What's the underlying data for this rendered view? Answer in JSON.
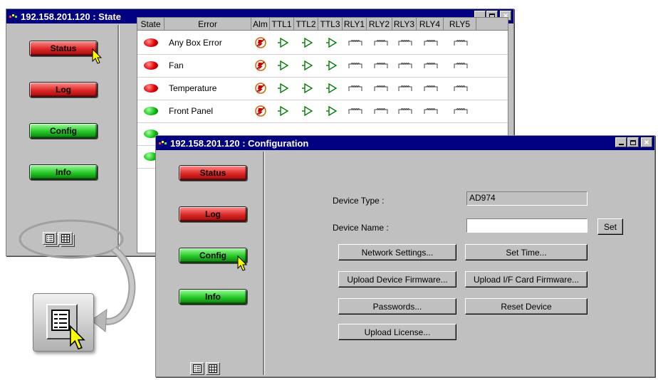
{
  "state_window": {
    "title": "192.158.201.120 : State",
    "nav": [
      {
        "label": "Status",
        "color": "red"
      },
      {
        "label": "Log",
        "color": "red"
      },
      {
        "label": "Config",
        "color": "green"
      },
      {
        "label": "Info",
        "color": "green"
      }
    ],
    "columns": [
      "State",
      "Error",
      "Alm",
      "TTL1",
      "TTL2",
      "TTL3",
      "RLY1",
      "RLY2",
      "RLY3",
      "RLY4",
      "RLY5"
    ],
    "rows": [
      {
        "state": "red",
        "error": "Any Box Error"
      },
      {
        "state": "red",
        "error": "Fan"
      },
      {
        "state": "red",
        "error": "Temperature"
      },
      {
        "state": "green",
        "error": "Front Panel"
      },
      {
        "state": "green",
        "error": ""
      },
      {
        "state": "green",
        "error": ""
      }
    ]
  },
  "config_window": {
    "title": "192.158.201.120 : Configuration",
    "nav": [
      {
        "label": "Status",
        "color": "red"
      },
      {
        "label": "Log",
        "color": "red"
      },
      {
        "label": "Config",
        "color": "green"
      },
      {
        "label": "Info",
        "color": "green"
      }
    ],
    "device_type_label": "Device Type :",
    "device_type_value": "AD974",
    "device_name_label": "Device Name :",
    "device_name_value": "",
    "set_label": "Set",
    "buttons": {
      "network_settings": "Network Settings...",
      "set_time": "Set Time...",
      "upload_device_firmware": "Upload Device Firmware...",
      "upload_if_card_firmware": "Upload I/F Card Firmware...",
      "passwords": "Passwords...",
      "reset_device": "Reset Device",
      "upload_license": "Upload License..."
    }
  },
  "colors": {
    "title_bar": "#000080",
    "window_bg": "#c0c0c0",
    "nav_red": "#dd2626",
    "nav_green": "#25c825"
  },
  "icons": [
    "alarm-disabled-icon",
    "ttl-output-icon",
    "relay-icon",
    "list-view-icon",
    "grid-view-icon",
    "mouse-cursor-icon"
  ]
}
